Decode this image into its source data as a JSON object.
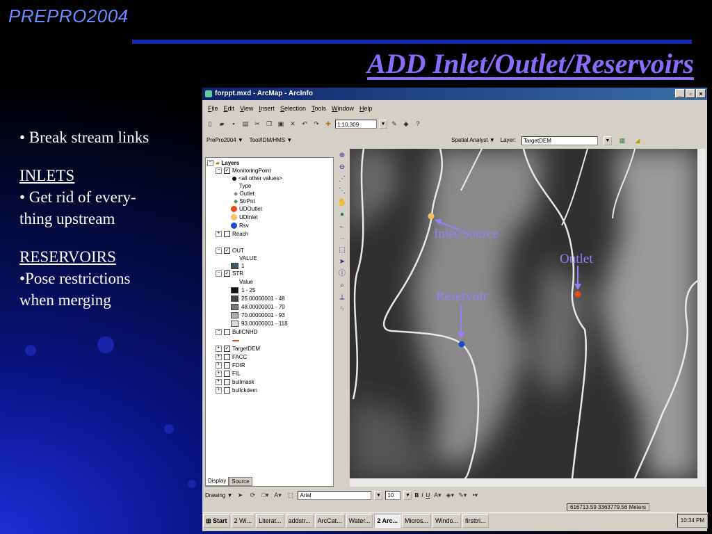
{
  "slide": {
    "brand": "PREPRO2004",
    "title": "ADD Inlet/Outlet/Reservoirs",
    "bullets": {
      "b1": "• Break stream links",
      "inlets_head": "INLETS",
      "inlets_text1": "• Get rid of every-",
      "inlets_text2": "thing upstream",
      "res_head": "RESERVOIRS",
      "res_text1": "•Pose restrictions",
      "res_text2": "when merging"
    }
  },
  "window": {
    "title": "forppt.mxd - ArcMap - ArcInfo",
    "buttons": {
      "min": "_",
      "max": "▫",
      "close": "×"
    },
    "menu": [
      "File",
      "Edit",
      "View",
      "Insert",
      "Selection",
      "Tools",
      "Window",
      "Help"
    ],
    "scale": "1:10,309",
    "prepro_toolbar": "PrePro2004 ▼",
    "tool_toolbar": "Tool/IDM/HMS ▼",
    "spatial_analyst": "Spatial Analyst ▼",
    "layer_label": "Layer:",
    "layer_value": "TargetDEM"
  },
  "toc": {
    "layers_root": "Layers",
    "monitoring_point": "MonitoringPoint",
    "all_other": "<all other values>",
    "type": "Type",
    "outlet": "Outlet",
    "strpnt": "StrPnt",
    "udoutlet": "UDOutlet",
    "udinlet": "UDInlet",
    "rsv": "Rsv",
    "reach": "Reach",
    "out": "OUT",
    "out_value": "VALUE",
    "out_1": "1",
    "str": "STR",
    "str_value": "Value",
    "str_classes": [
      "1 - 25",
      "25.00000001 - 48",
      "48.00000001 - 70",
      "70.00000001 - 93",
      "93.00000001 - 118"
    ],
    "bullcnhd": "BullCNHD",
    "target_dem": "TargetDEM",
    "facc": "FACC",
    "fdir": "FDIR",
    "fil": "FIL",
    "bullmask": "bullmask",
    "bullckdem": "bullckdem",
    "tab_display": "Display",
    "tab_source": "Source"
  },
  "map_annotations": {
    "inlet": "Inlet/Source",
    "outlet": "Outlet",
    "reservoir": "Reservoir"
  },
  "drawing": {
    "label": "Drawing ▼",
    "font": "Arial",
    "size": "10",
    "bold": "B",
    "italic": "I",
    "underline": "U"
  },
  "status_coords": "616713.59  3363779.56 Meters",
  "taskbar": {
    "start": "Start",
    "tasks": [
      "2 Wi...",
      "Literat...",
      "addstr...",
      "ArcCat...",
      "Water...",
      "2 Arc...",
      "Micros...",
      "Windo...",
      "firsttri..."
    ],
    "active_index": 5,
    "time": "10:34 PM"
  },
  "colors": {
    "title": "#8a6cff",
    "brand": "#6a8cff",
    "udoutlet": "#e84a10",
    "udinlet": "#f4c060",
    "rsv": "#1a4ad0",
    "annotation": "#9a7cff"
  }
}
